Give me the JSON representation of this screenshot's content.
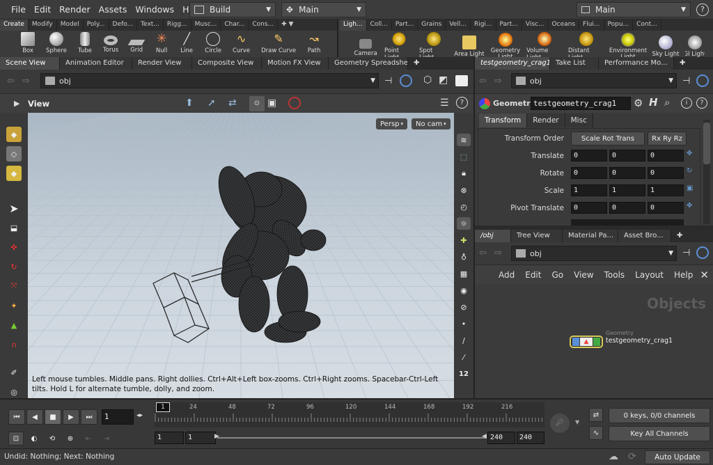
{
  "menubar": {
    "menus": [
      "File",
      "Edit",
      "Render",
      "Assets",
      "Windows",
      "Help"
    ],
    "desktop": "Build",
    "context": "Main",
    "desktop_right": "Main"
  },
  "shelf_left": {
    "tabs": [
      "Create",
      "Modify",
      "Model",
      "Poly...",
      "Defo...",
      "Text...",
      "Rigg...",
      "Musc...",
      "Char...",
      "Cons..."
    ],
    "tools": [
      "Box",
      "Sphere",
      "Tube",
      "Torus",
      "Grid",
      "Null",
      "Line",
      "Circle",
      "Curve",
      "Draw Curve",
      "Path"
    ]
  },
  "shelf_right": {
    "tabs": [
      "Ligh...",
      "Coll...",
      "Part...",
      "Grains",
      "Vell...",
      "Rigi...",
      "Part...",
      "Visc...",
      "Oceans",
      "Flui...",
      "Popu...",
      "Cont..."
    ],
    "tools": [
      "Camera",
      "Point Light",
      "Spot Light",
      "Area Light",
      "Geometry Light",
      "Volume Light",
      "Distant Light",
      "Environment Light",
      "Sky Light",
      "GI Light"
    ]
  },
  "viewer": {
    "tabs": [
      "Scene View",
      "Animation Editor",
      "Render View",
      "Composite View",
      "Motion FX View",
      "Geometry Spreadsheet"
    ],
    "path": "obj",
    "title": "View",
    "persp": "Persp",
    "cam": "No cam",
    "hint": "Left mouse tumbles. Middle pans. Right dollies. Ctrl+Alt+Left box-zooms. Ctrl+Right zooms. Spacebar-Ctrl-Left tilts. Hold L for alternate tumble, dolly, and zoom.",
    "snap_num": "12"
  },
  "params": {
    "tabs": [
      "testgeometry_crag1",
      "Take List",
      "Performance Mo..."
    ],
    "path": "obj",
    "type": "Geometry",
    "node_name": "testgeometry_crag1",
    "subtabs": [
      "Transform",
      "Render",
      "Misc"
    ],
    "transform_order_label": "Transform Order",
    "transform_order": "Scale Rot Trans",
    "rot_order": "Rx Ry Rz",
    "rows": [
      {
        "label": "Translate",
        "values": [
          "0",
          "0",
          "0"
        ]
      },
      {
        "label": "Rotate",
        "values": [
          "0",
          "0",
          "0"
        ]
      },
      {
        "label": "Scale",
        "values": [
          "1",
          "1",
          "1"
        ]
      },
      {
        "label": "Pivot Translate",
        "values": [
          "0",
          "0",
          "0"
        ]
      }
    ]
  },
  "network": {
    "tabs": [
      "/obj",
      "Tree View",
      "Material Pa...",
      "Asset Bro..."
    ],
    "path": "obj",
    "menus": [
      "Add",
      "Edit",
      "Go",
      "View",
      "Tools",
      "Layout",
      "Help"
    ],
    "watermark": "Objects",
    "node_type": "Geometry",
    "node_name": "testgeometry_crag1"
  },
  "timeline": {
    "frame": "1",
    "marker": "1",
    "ticks": [
      "24",
      "48",
      "72",
      "96",
      "120",
      "144",
      "168",
      "192",
      "216"
    ],
    "start1": "1",
    "start2": "1",
    "end1": "240",
    "end2": "240",
    "keys_info": "0 keys, 0/0 channels",
    "key_all": "Key All Channels"
  },
  "status": {
    "message": "Undid: Nothing; Next: Nothing",
    "auto_update": "Auto Update"
  },
  "colors": {
    "viewport_top": "#a7b6c3",
    "viewport_bottom": "#d4dbe1",
    "accent_blue": "#5a8fd6",
    "node_geo": "#d8c95a"
  }
}
